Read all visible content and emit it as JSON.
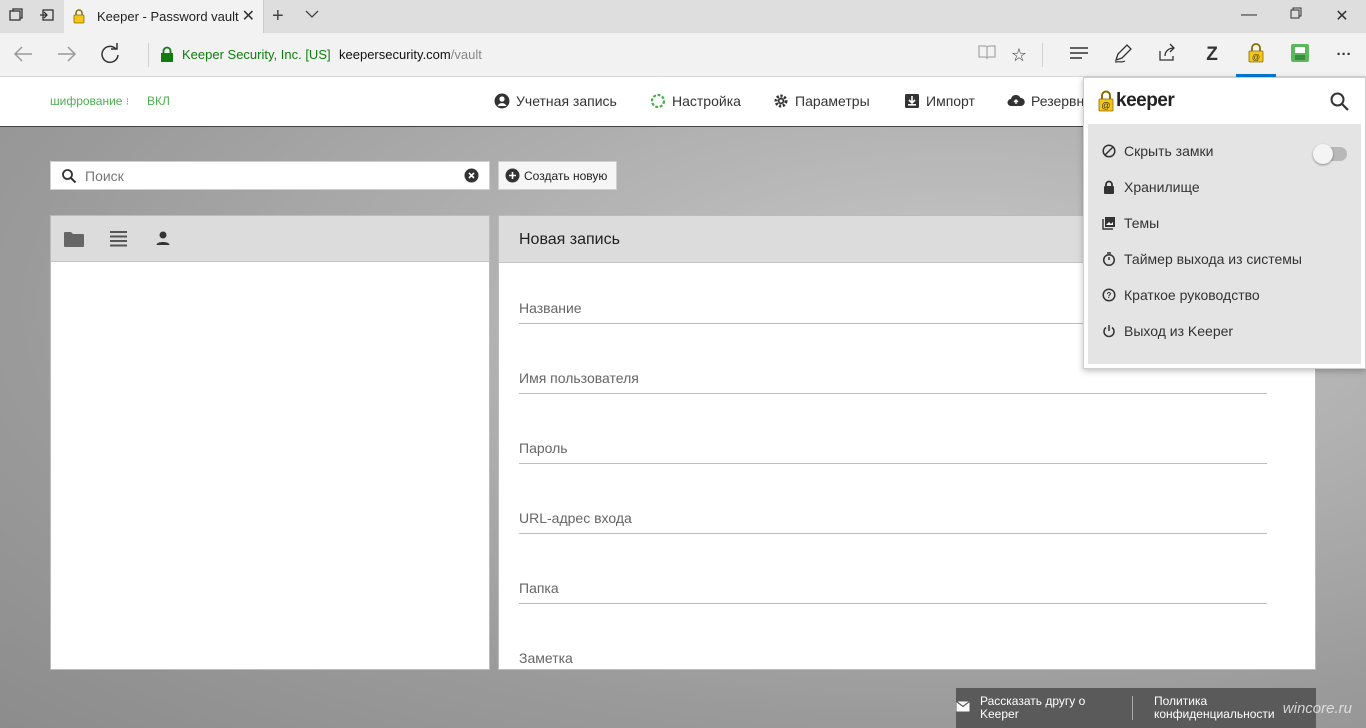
{
  "browser": {
    "tab_title": "Keeper - Password vault",
    "site_identity": "Keeper Security, Inc. [US]",
    "url_host": "keepersecurity.com",
    "url_path": "/vault",
    "icons": [
      "tab-manager-icon",
      "set-aside-tabs-icon",
      "lock-icon",
      "close-icon",
      "new-tab-icon",
      "chevron-down-icon",
      "minimize-icon",
      "maximize-icon",
      "window-close-icon",
      "back-icon",
      "forward-icon",
      "refresh-icon",
      "reading-view-icon",
      "favorite-star-icon",
      "hub-icon",
      "pen-icon",
      "share-icon",
      "zotero-icon",
      "keeper-extension-icon",
      "save-page-icon",
      "more-icon"
    ],
    "zotero_label": "Z",
    "more_label": "···"
  },
  "app_nav": {
    "encryption_label": "шифрование",
    "encryption_value": "ВКЛ",
    "items": [
      {
        "label": "Учетная запись",
        "icon": "account-icon"
      },
      {
        "label": "Настройка",
        "icon": "setup-progress-icon"
      },
      {
        "label": "Параметры",
        "icon": "gear-icon"
      },
      {
        "label": "Импорт",
        "icon": "import-icon"
      },
      {
        "label": "Резервн",
        "icon": "cloud-upload-icon"
      }
    ]
  },
  "vault": {
    "search_placeholder": "Поиск",
    "create_button": "Создать новую",
    "view_icons": [
      "folder-icon",
      "list-icon",
      "person-icon"
    ],
    "record_title": "Новая запись",
    "fields": [
      "Название",
      "Имя пользователя",
      "Пароль",
      "URL-адрес входа",
      "Папка",
      "Заметка"
    ]
  },
  "footer": {
    "tell_friend_line1": "Рассказать другу о",
    "tell_friend_line2": "Keeper",
    "privacy_line1": "Политика",
    "privacy_line2": "конфиденциальности",
    "watermark": "wincore.ru"
  },
  "popup": {
    "brand": "keeper",
    "items": [
      {
        "label": "Скрыть замки",
        "icon": "block-icon",
        "toggle": false
      },
      {
        "label": "Хранилище",
        "icon": "lock-icon"
      },
      {
        "label": "Темы",
        "icon": "themes-icon"
      },
      {
        "label": "Таймер выхода из системы",
        "icon": "timer-icon"
      },
      {
        "label": "Краткое руководство",
        "icon": "help-icon"
      },
      {
        "label": "Выход из Keeper",
        "icon": "power-icon"
      }
    ]
  },
  "colors": {
    "green_accent": "#4caf50",
    "secure_green": "#107c10",
    "keeper_yellow": "#f5c518",
    "edge_blue": "#0078d7"
  }
}
